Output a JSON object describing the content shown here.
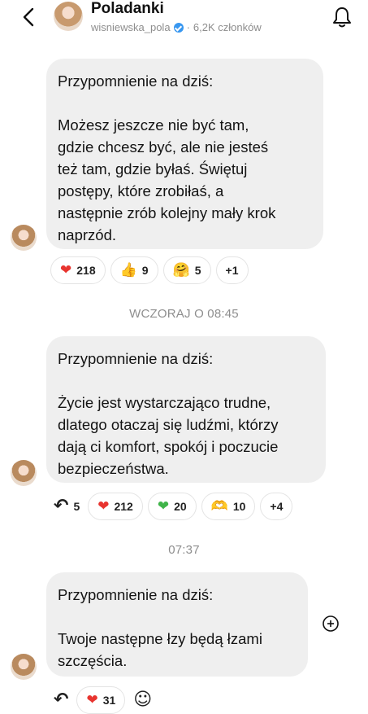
{
  "header": {
    "title": "Poladanki",
    "username": "wisniewska_pola",
    "separator": "·",
    "members": "6,2K członków"
  },
  "messages": [
    {
      "head": "Przypomnienie na dziś:",
      "lines": [
        "Możesz jeszcze nie być tam,",
        "gdzie chcesz być, ale nie jesteś",
        "też tam, gdzie byłaś. Świętuj",
        "postępy, które zrobiłaś, a",
        "następnie zrób kolejny mały krok",
        "naprzód."
      ],
      "reactions": [
        {
          "icon": "red-heart",
          "glyph": "❤",
          "count": "218"
        },
        {
          "icon": "thumbs-up",
          "glyph": "👍",
          "count": "9"
        },
        {
          "icon": "hugging-face",
          "glyph": "🤗",
          "count": "5"
        },
        {
          "icon": "",
          "glyph": "",
          "count": "+1"
        }
      ]
    },
    {
      "separator": "WCZORAJ O 08:45",
      "head": "Przypomnienie na dziś:",
      "lines": [
        "Życie jest wystarczająco trudne,",
        "dlatego otaczaj się ludźmi, którzy",
        "dają ci komfort, spokój i poczucie",
        "bezpieczeństwa."
      ],
      "reactions": [
        {
          "icon": "reply-arrow",
          "glyph": "↶",
          "count": "5"
        },
        {
          "icon": "red-heart",
          "glyph": "❤",
          "count": "212"
        },
        {
          "icon": "green-heart",
          "glyph": "❤",
          "count": "20"
        },
        {
          "icon": "heart-hands",
          "glyph": "🫶",
          "count": "10"
        },
        {
          "icon": "",
          "glyph": "",
          "count": "+4"
        }
      ]
    },
    {
      "separator": "07:37",
      "head": "Przypomnienie na dziś:",
      "lines": [
        "Twoje następne łzy będą łzami",
        "szczęścia."
      ],
      "reactions": [
        {
          "icon": "reply-arrow",
          "glyph": "↶",
          "count": ""
        },
        {
          "icon": "red-heart",
          "glyph": "❤",
          "count": "31"
        },
        {
          "icon": "add-reaction",
          "glyph": "☺",
          "count": ""
        }
      ]
    }
  ],
  "colors": {
    "bubble": "#efefef",
    "verified": "#3897f0",
    "heart": "#e8342f",
    "green": "#3fb449"
  }
}
